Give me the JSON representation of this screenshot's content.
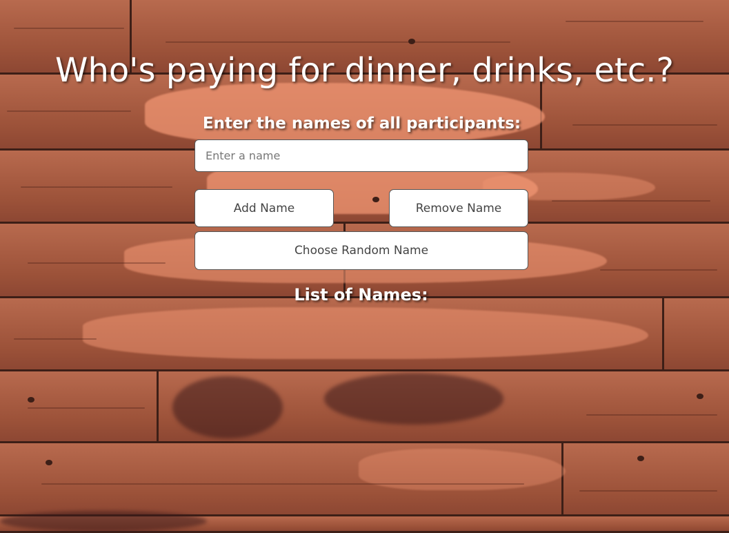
{
  "header": {
    "title": "Who's paying for dinner, drinks, etc.?"
  },
  "form": {
    "prompt": "Enter the names of all participants:",
    "name_input": {
      "placeholder": "Enter a name",
      "value": ""
    },
    "add_label": "Add Name",
    "remove_label": "Remove Name",
    "random_label": "Choose Random Name"
  },
  "names": {
    "heading": "List of Names:",
    "items": []
  },
  "colors": {
    "wood_base": "#a0583f",
    "wood_light": "#f0966f",
    "wood_seam": "#3d1f17",
    "text_light": "#ffffff",
    "button_bg": "#ffffff",
    "button_text": "#444444"
  }
}
